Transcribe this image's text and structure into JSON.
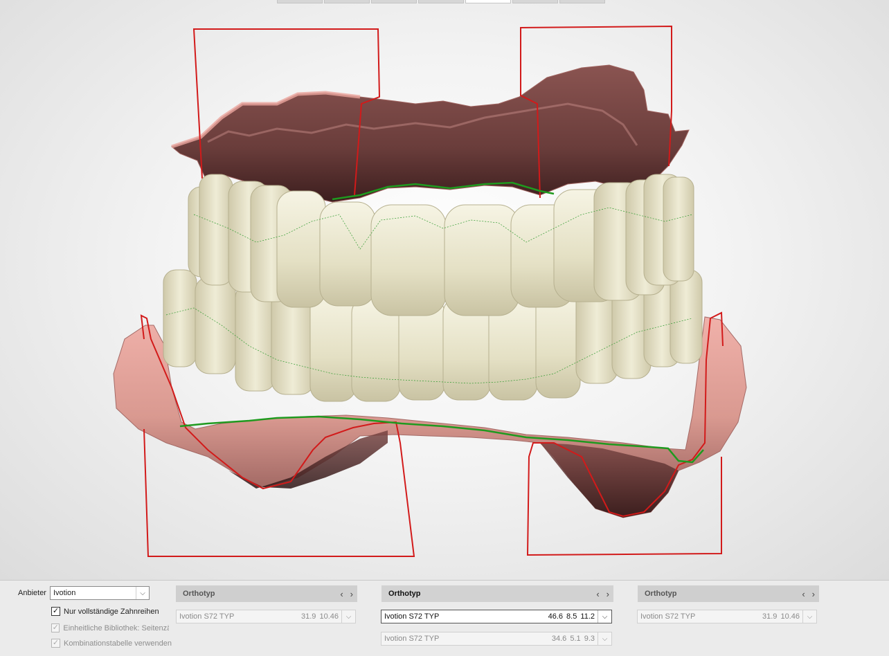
{
  "provider": {
    "label": "Anbieter",
    "value": "Ivotion"
  },
  "options": [
    {
      "label": "Nur vollständige Zahnreihen",
      "checked": true,
      "enabled": true
    },
    {
      "label": "Einheitliche Bibliothek: Seitenzäh",
      "checked": true,
      "enabled": false
    },
    {
      "label": "Kombinationstabelle verwenden",
      "checked": true,
      "enabled": false
    }
  ],
  "columns": [
    {
      "header": "Orthotyp",
      "rows": [
        {
          "name": "Ivotion S72 TYP",
          "values": "31.9  10.46"
        }
      ]
    },
    {
      "header": "Orthotyp",
      "rows": [
        {
          "name": "Ivotion S72 TYP",
          "values": "46.6  8.5  11.2"
        },
        {
          "name": "Ivotion S72 TYP",
          "values": "34.6  5.1  9.3"
        }
      ]
    },
    {
      "header": "Orthotyp",
      "rows": [
        {
          "name": "Ivotion S72 TYP",
          "values": "31.9  10.46"
        }
      ]
    }
  ],
  "icons": {
    "prev": "‹",
    "next": "›",
    "dropdown": "⌵",
    "check": "✓"
  },
  "colors": {
    "gingiva": "#e9a19a",
    "gingiva_dark": "#6a3a38",
    "teeth": "#e6e2c6",
    "boundary_red": "#d21a1a",
    "margin_green": "#1f9a1f"
  }
}
